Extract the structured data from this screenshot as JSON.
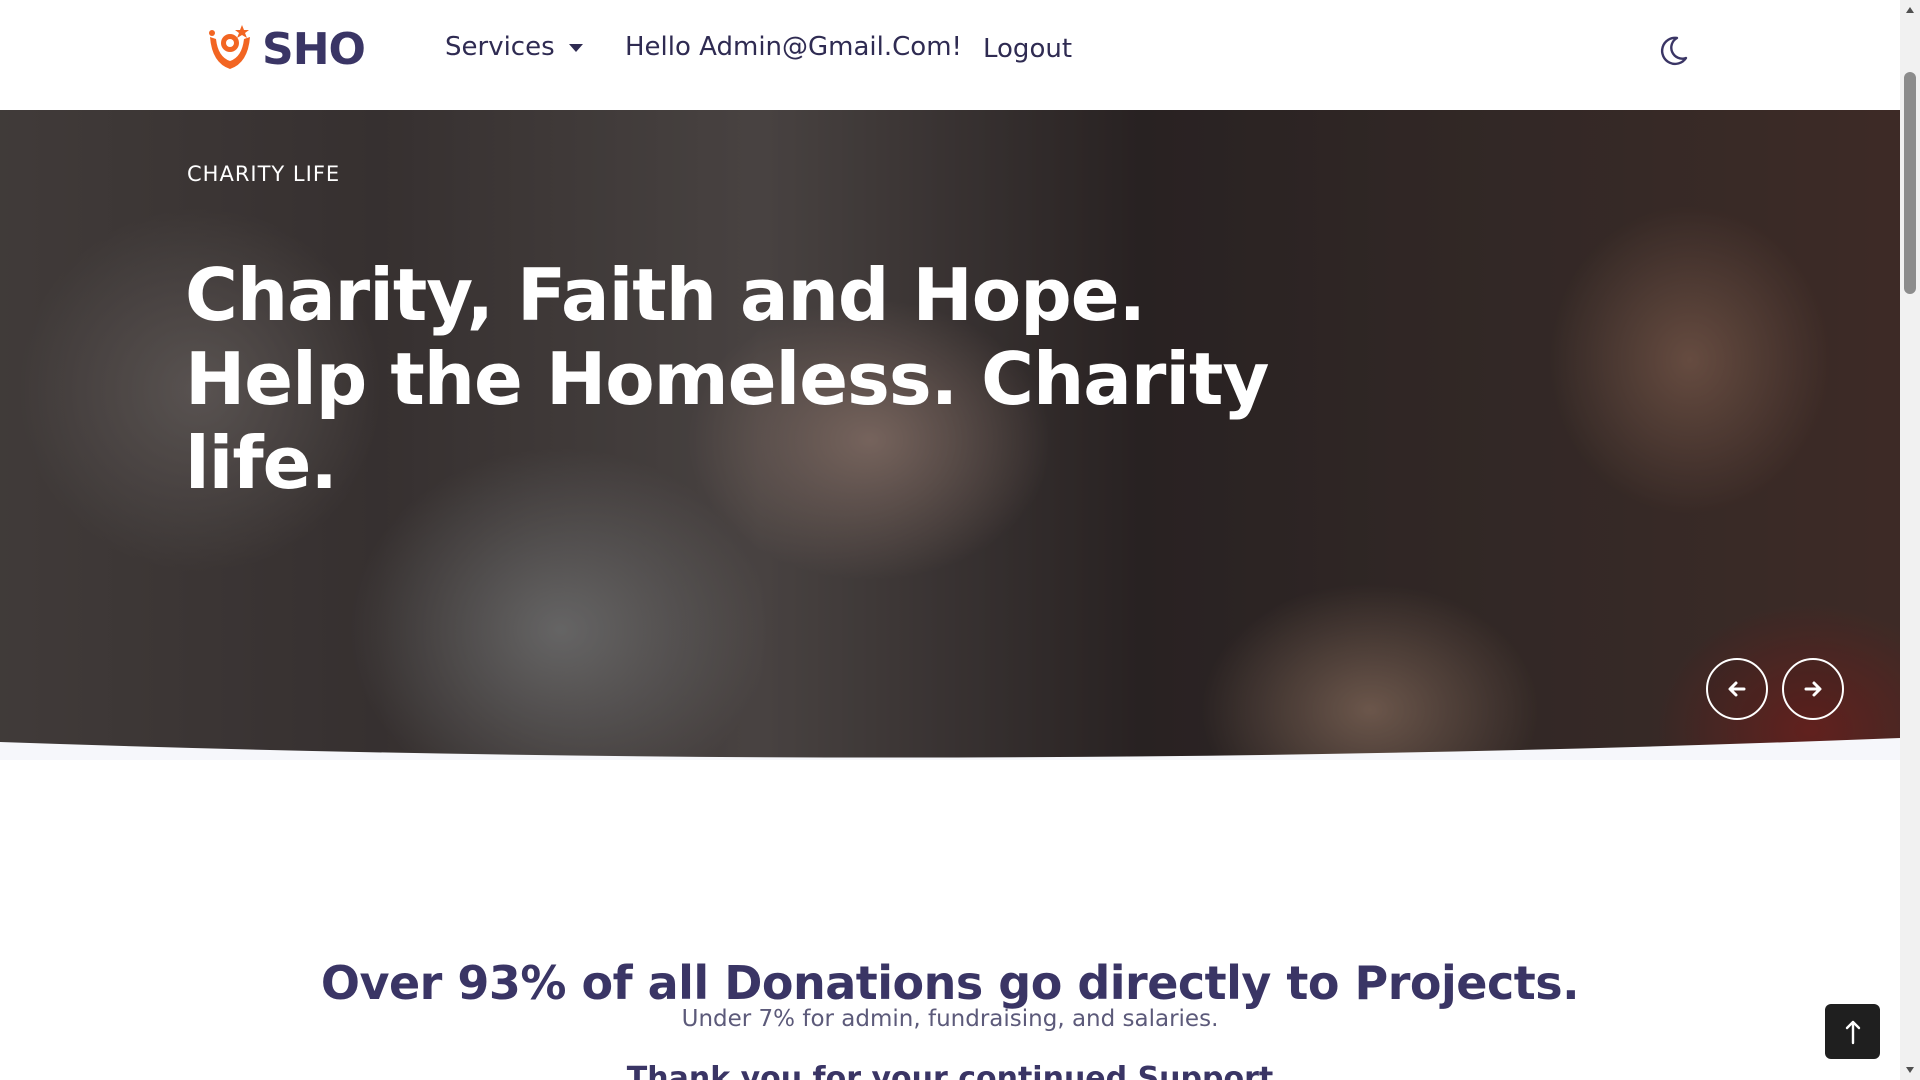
{
  "navbar": {
    "brand": "SHO",
    "services_label": "Services",
    "greeting": "Hello Admin@Gmail.Com!",
    "logout_label": "Logout",
    "theme_icon": "moon-icon"
  },
  "hero": {
    "kicker": "CHARITY LIFE",
    "title": "Charity, Faith and Hope. Help the Homeless. Charity life.",
    "prev_icon": "arrow-left-icon",
    "next_icon": "arrow-right-icon"
  },
  "content": {
    "title": "Over 93% of all Donations go directly to Projects.",
    "subtitle": "Under 7% for admin, fundraising, and salaries.",
    "thanks": "Thank you for your continued Support"
  },
  "back_to_top_icon": "arrow-up-icon",
  "colors": {
    "brand_orange": "#f26522",
    "brand_navy": "#3a3565",
    "text_muted": "#5c5a7a"
  }
}
